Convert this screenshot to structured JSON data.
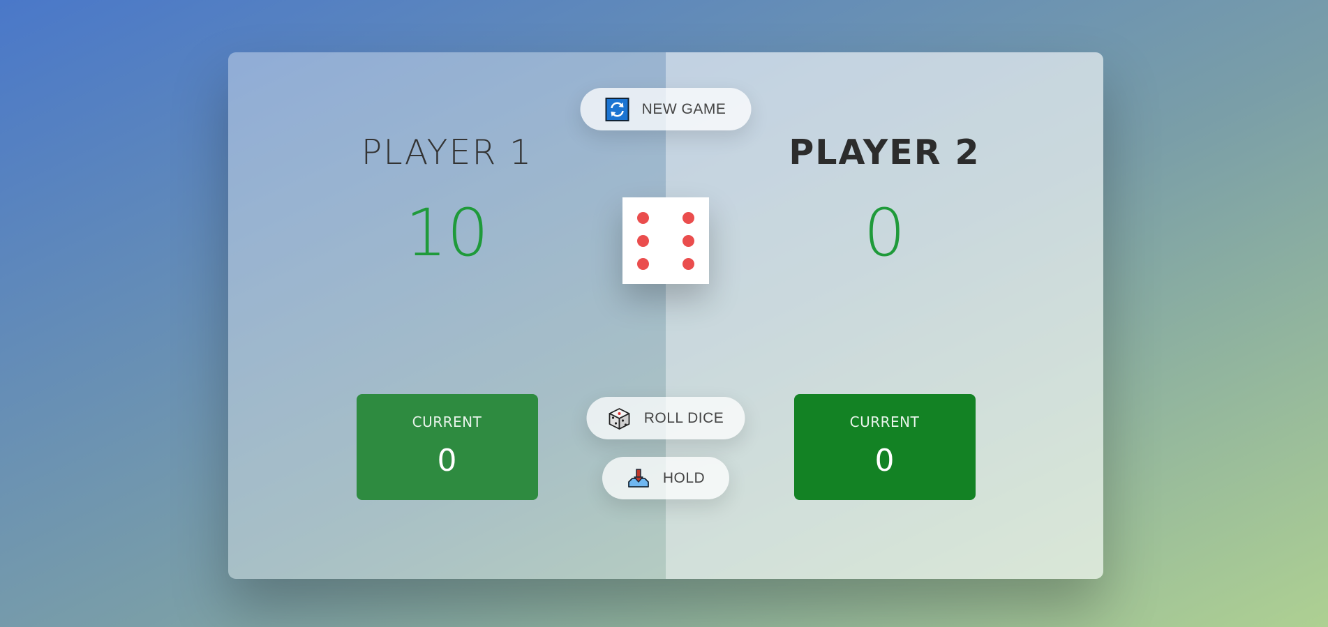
{
  "new_game_button": {
    "label": "NEW GAME",
    "icon": "refresh-icon"
  },
  "roll_button": {
    "label": "ROLL DICE",
    "icon": "dice-icon"
  },
  "hold_button": {
    "label": "HOLD",
    "icon": "hold-icon"
  },
  "dice": {
    "value": 6,
    "pip_color": "#ea4d4d"
  },
  "players": [
    {
      "name": "PLAYER 1",
      "score": "10",
      "current_label": "CURRENT",
      "current_score": "0",
      "active": false
    },
    {
      "name": "PLAYER 2",
      "score": "0",
      "current_label": "CURRENT",
      "current_score": "0",
      "active": true
    }
  ],
  "colors": {
    "score": "#1f9a3a",
    "current_box_1": "#2e8b40",
    "current_box_2": "#138224"
  }
}
